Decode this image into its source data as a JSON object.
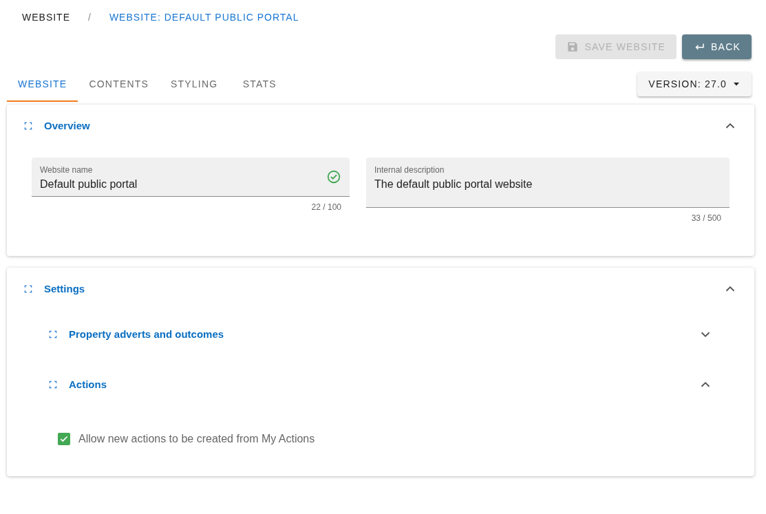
{
  "breadcrumb_separator": "/",
  "breadcrumb": [
    {
      "label": "WEBSITE",
      "selected": false
    },
    {
      "label": "WEBSITE: DEFAULT PUBLIC PORTAL",
      "selected": true
    }
  ],
  "actions": [
    {
      "kind": "save",
      "label": "SAVE WEBSITE",
      "disabled": true
    },
    {
      "kind": "back",
      "label": "BACK",
      "disabled": false
    }
  ],
  "tabs": [
    {
      "label": "WEBSITE",
      "selected": true
    },
    {
      "label": "CONTENTS",
      "selected": false
    },
    {
      "label": "STYLING",
      "selected": false
    },
    {
      "label": "STATS",
      "selected": false
    }
  ],
  "version": {
    "label": "VERSION: 27.0"
  },
  "panels": [
    {
      "title": "Overview",
      "expanded": true,
      "fields": [
        {
          "label": "Website name",
          "value": "Default public portal",
          "counter": "22 / 100",
          "valid": true,
          "multiline": false
        },
        {
          "label": "Internal description",
          "value": "The default public portal website",
          "counter": "33 / 500",
          "valid": false,
          "multiline": true
        }
      ]
    },
    {
      "title": "Settings",
      "expanded": true,
      "sections": [
        {
          "title": "Property adverts and outcomes",
          "expanded": false
        },
        {
          "title": "Actions",
          "expanded": true,
          "checkboxes": [
            {
              "label": "Allow new actions to be created from My Actions",
              "checked": true
            }
          ]
        }
      ]
    }
  ]
}
